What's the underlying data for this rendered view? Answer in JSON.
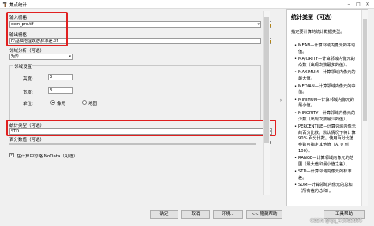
{
  "window": {
    "title": "焦点统计"
  },
  "form": {
    "input_raster_label": "输入栅格",
    "input_raster_value": "dem_pro.tif",
    "output_raster_label": "输出栅格",
    "output_raster_value": "F:\\基础地理数据\\标准差.tif",
    "neighborhood_label": "邻域分析（可选）",
    "neighborhood_value": "矩形",
    "neighborhood_settings_label": "邻域设置",
    "height_label": "高度:",
    "height_value": "3",
    "width_label": "宽度:",
    "width_value": "3",
    "units_label": "单位:",
    "unit_cell": "像元",
    "unit_map": "地图",
    "stat_type_label": "统计类型（可选）",
    "stat_type_value": "STD",
    "percentile_label": "百分数值（可选）",
    "percentile_value": "90",
    "ignore_nodata_label": "在计算中忽略 NoData（可选）",
    "ignore_nodata_checked": true
  },
  "help": {
    "title": "统计类型（可选）",
    "intro": "指定要计算的统计数据类型。",
    "items": [
      "MEAN—计算邻域内像元的平均值。",
      "MAJORITY—计算邻域内像元的众数（出现次数最多的值）。",
      "MAXIMUM—计算邻域内像元的最大值。",
      "MEDIAN—计算邻域内像元的中值。",
      "MINIMUM—计算邻域内像元的最小值。",
      "MINORITY—计算邻域内像元的少数（出现次数最少的值）。",
      "PERCENTILE—计算邻域内像元的百分比数。默认情况下将计算 90% 百分比数。使用百分比值参数可指定其他值（从 0 到 100）。",
      "RANGE—计算邻域内像元的范围（最大值和最小值之差）。",
      "STD—计算邻域内像元的标准差。",
      "SUM—计算邻域内像元的总和（所有值的总和）。"
    ]
  },
  "buttons": {
    "ok": "确定",
    "cancel": "取消",
    "env": "环境...",
    "hide_help": "<< 隐藏帮助",
    "tool_help": "工具帮助"
  },
  "watermark": "CSDN @qq_41883895",
  "colors": {
    "highlight_border": "#e02020"
  }
}
